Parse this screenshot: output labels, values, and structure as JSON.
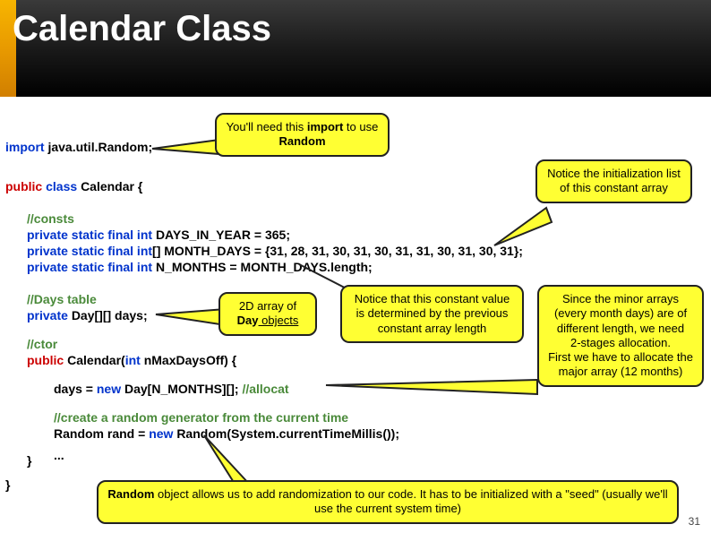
{
  "header": {
    "title": "Calendar Class"
  },
  "code": {
    "l1_import": "import ",
    "l1_rest": "java.util.Random;",
    "l2_public": "public ",
    "l2_class": "class ",
    "l2_rest": "Calendar {",
    "c1": "//consts",
    "l3a": "private static final int ",
    "l3b": "DAYS_IN_YEAR = 365;",
    "l4a": "private static final int",
    "l4b": "[] MONTH_DAYS = {31, 28, 31, 30, 31, 30, 31, 31, 30, 31, 30, 31};",
    "l5a": "private static final int ",
    "l5b": "N_MONTHS = MONTH_DAYS.length;",
    "c2": "//Days table",
    "l6a": "private ",
    "l6b": "Day[][] days;",
    "c3": "//ctor",
    "l7a": "public ",
    "l7b": "Calendar(",
    "l7c": "int ",
    "l7d": "nMaxDaysOff) {",
    "l8a": "days = ",
    "l8b": "new ",
    "l8c": "Day[N_MONTHS][]; ",
    "l8d": "//allocat",
    "c4": "//create a random generator from the current time",
    "l9a": "Random rand = ",
    "l9b": "new ",
    "l9c": "Random(System.currentTimeMillis());",
    "l10": "...",
    "l11": "}",
    "l12": "}"
  },
  "callouts": {
    "a": {
      "line1": "You'll need this ",
      "bold1": "import",
      "line2": " to use ",
      "bold2": "Random"
    },
    "b": "Notice the initialization list of this constant array",
    "c": {
      "line1": "2D array of ",
      "bold": "Day",
      "u": " objects"
    },
    "d": "Notice that this constant value is determined by the previous constant array length",
    "e": "Since the minor arrays (every month days) are of different length, we need\n2-stages allocation.\nFirst we have to allocate the major array (12 months)",
    "f": {
      "bold": "Random",
      "line": " object allows us to add randomization to our code. It has to be initialized with a \"seed\" (usually we'll use the current system time)"
    }
  },
  "page": "31"
}
